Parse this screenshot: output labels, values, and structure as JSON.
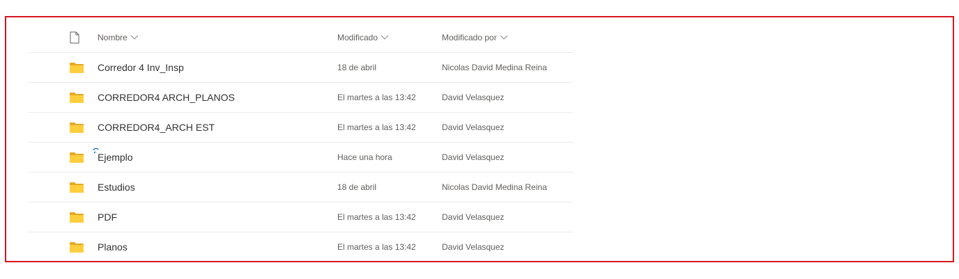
{
  "columns": {
    "name": "Nombre",
    "modified": "Modificado",
    "modified_by": "Modificado por"
  },
  "rows": [
    {
      "name": "Corredor 4 Inv_Insp",
      "modified": "18 de abril",
      "modified_by": "Nicolas David Medina Reina"
    },
    {
      "name": "CORREDOR4 ARCH_PLANOS",
      "modified": "El martes a las 13:42",
      "modified_by": "David Velasquez"
    },
    {
      "name": "CORREDOR4_ARCH EST",
      "modified": "El martes a las 13:42",
      "modified_by": "David Velasquez"
    },
    {
      "name": "Ejemplo",
      "modified": "Hace una hora",
      "modified_by": "David Velasquez"
    },
    {
      "name": "Estudios",
      "modified": "18 de abril",
      "modified_by": "Nicolas David Medina Reina"
    },
    {
      "name": "PDF",
      "modified": "El martes a las 13:42",
      "modified_by": "David Velasquez"
    },
    {
      "name": "Planos",
      "modified": "El martes a las 13:42",
      "modified_by": "David Velasquez"
    }
  ],
  "colors": {
    "folder": "#ffce3d",
    "folder_back": "#e8a825",
    "highlight_border": "#d9141e",
    "sync_indicator": "#0f6cbd"
  },
  "icons": {
    "file_type_header": "file-type-icon",
    "folder": "folder-icon",
    "sort": "chevron-down-icon",
    "new_item": "sync-spinner-icon"
  }
}
